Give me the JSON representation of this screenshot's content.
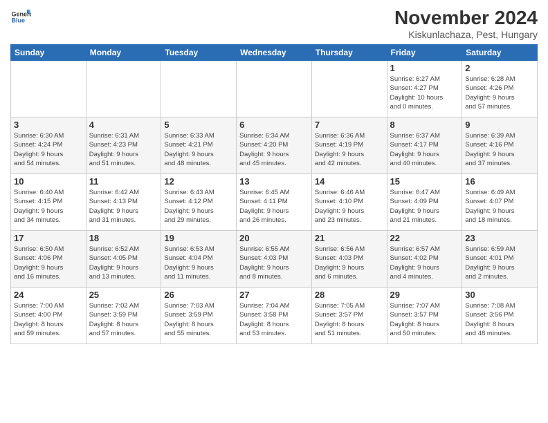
{
  "logo": {
    "line1": "General",
    "line2": "Blue"
  },
  "title": "November 2024",
  "location": "Kiskunlachaza, Pest, Hungary",
  "weekdays": [
    "Sunday",
    "Monday",
    "Tuesday",
    "Wednesday",
    "Thursday",
    "Friday",
    "Saturday"
  ],
  "weeks": [
    [
      {
        "day": "",
        "info": ""
      },
      {
        "day": "",
        "info": ""
      },
      {
        "day": "",
        "info": ""
      },
      {
        "day": "",
        "info": ""
      },
      {
        "day": "",
        "info": ""
      },
      {
        "day": "1",
        "info": "Sunrise: 6:27 AM\nSunset: 4:27 PM\nDaylight: 10 hours\nand 0 minutes."
      },
      {
        "day": "2",
        "info": "Sunrise: 6:28 AM\nSunset: 4:26 PM\nDaylight: 9 hours\nand 57 minutes."
      }
    ],
    [
      {
        "day": "3",
        "info": "Sunrise: 6:30 AM\nSunset: 4:24 PM\nDaylight: 9 hours\nand 54 minutes."
      },
      {
        "day": "4",
        "info": "Sunrise: 6:31 AM\nSunset: 4:23 PM\nDaylight: 9 hours\nand 51 minutes."
      },
      {
        "day": "5",
        "info": "Sunrise: 6:33 AM\nSunset: 4:21 PM\nDaylight: 9 hours\nand 48 minutes."
      },
      {
        "day": "6",
        "info": "Sunrise: 6:34 AM\nSunset: 4:20 PM\nDaylight: 9 hours\nand 45 minutes."
      },
      {
        "day": "7",
        "info": "Sunrise: 6:36 AM\nSunset: 4:19 PM\nDaylight: 9 hours\nand 42 minutes."
      },
      {
        "day": "8",
        "info": "Sunrise: 6:37 AM\nSunset: 4:17 PM\nDaylight: 9 hours\nand 40 minutes."
      },
      {
        "day": "9",
        "info": "Sunrise: 6:39 AM\nSunset: 4:16 PM\nDaylight: 9 hours\nand 37 minutes."
      }
    ],
    [
      {
        "day": "10",
        "info": "Sunrise: 6:40 AM\nSunset: 4:15 PM\nDaylight: 9 hours\nand 34 minutes."
      },
      {
        "day": "11",
        "info": "Sunrise: 6:42 AM\nSunset: 4:13 PM\nDaylight: 9 hours\nand 31 minutes."
      },
      {
        "day": "12",
        "info": "Sunrise: 6:43 AM\nSunset: 4:12 PM\nDaylight: 9 hours\nand 29 minutes."
      },
      {
        "day": "13",
        "info": "Sunrise: 6:45 AM\nSunset: 4:11 PM\nDaylight: 9 hours\nand 26 minutes."
      },
      {
        "day": "14",
        "info": "Sunrise: 6:46 AM\nSunset: 4:10 PM\nDaylight: 9 hours\nand 23 minutes."
      },
      {
        "day": "15",
        "info": "Sunrise: 6:47 AM\nSunset: 4:09 PM\nDaylight: 9 hours\nand 21 minutes."
      },
      {
        "day": "16",
        "info": "Sunrise: 6:49 AM\nSunset: 4:07 PM\nDaylight: 9 hours\nand 18 minutes."
      }
    ],
    [
      {
        "day": "17",
        "info": "Sunrise: 6:50 AM\nSunset: 4:06 PM\nDaylight: 9 hours\nand 16 minutes."
      },
      {
        "day": "18",
        "info": "Sunrise: 6:52 AM\nSunset: 4:05 PM\nDaylight: 9 hours\nand 13 minutes."
      },
      {
        "day": "19",
        "info": "Sunrise: 6:53 AM\nSunset: 4:04 PM\nDaylight: 9 hours\nand 11 minutes."
      },
      {
        "day": "20",
        "info": "Sunrise: 6:55 AM\nSunset: 4:03 PM\nDaylight: 9 hours\nand 8 minutes."
      },
      {
        "day": "21",
        "info": "Sunrise: 6:56 AM\nSunset: 4:03 PM\nDaylight: 9 hours\nand 6 minutes."
      },
      {
        "day": "22",
        "info": "Sunrise: 6:57 AM\nSunset: 4:02 PM\nDaylight: 9 hours\nand 4 minutes."
      },
      {
        "day": "23",
        "info": "Sunrise: 6:59 AM\nSunset: 4:01 PM\nDaylight: 9 hours\nand 2 minutes."
      }
    ],
    [
      {
        "day": "24",
        "info": "Sunrise: 7:00 AM\nSunset: 4:00 PM\nDaylight: 8 hours\nand 59 minutes."
      },
      {
        "day": "25",
        "info": "Sunrise: 7:02 AM\nSunset: 3:59 PM\nDaylight: 8 hours\nand 57 minutes."
      },
      {
        "day": "26",
        "info": "Sunrise: 7:03 AM\nSunset: 3:59 PM\nDaylight: 8 hours\nand 55 minutes."
      },
      {
        "day": "27",
        "info": "Sunrise: 7:04 AM\nSunset: 3:58 PM\nDaylight: 8 hours\nand 53 minutes."
      },
      {
        "day": "28",
        "info": "Sunrise: 7:05 AM\nSunset: 3:57 PM\nDaylight: 8 hours\nand 51 minutes."
      },
      {
        "day": "29",
        "info": "Sunrise: 7:07 AM\nSunset: 3:57 PM\nDaylight: 8 hours\nand 50 minutes."
      },
      {
        "day": "30",
        "info": "Sunrise: 7:08 AM\nSunset: 3:56 PM\nDaylight: 8 hours\nand 48 minutes."
      }
    ]
  ]
}
